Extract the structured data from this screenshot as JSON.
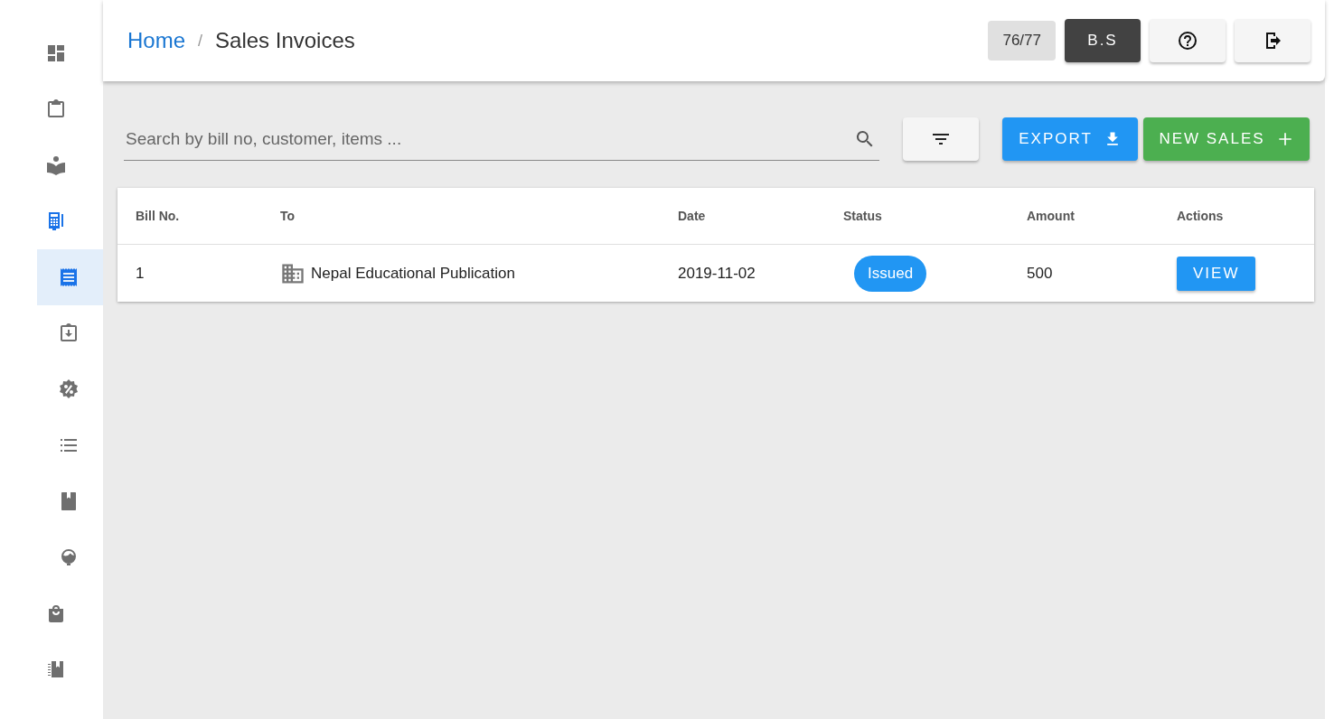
{
  "sidebar": {
    "items": [
      {
        "selected": false
      },
      {
        "selected": false
      },
      {
        "selected": false
      },
      {
        "selected": false,
        "expanded": true,
        "children": [
          {
            "selected": true
          },
          {
            "selected": false
          },
          {
            "selected": false
          },
          {
            "selected": false
          },
          {
            "selected": false
          },
          {
            "selected": false
          }
        ]
      },
      {
        "selected": false
      },
      {
        "selected": false
      }
    ]
  },
  "breadcrumb": {
    "home": "Home",
    "separator": "/",
    "current": "Sales Invoices"
  },
  "header": {
    "counter": "76/77",
    "calendar_button": "B.S"
  },
  "search": {
    "placeholder": "Search by bill no, customer, items ..."
  },
  "buttons": {
    "export": "EXPORT",
    "new_sales": "NEW SALES"
  },
  "table": {
    "columns": [
      "Bill No.",
      "To",
      "Date",
      "Status",
      "Amount",
      "Actions"
    ],
    "rows": [
      {
        "bill_no": "1",
        "to": "Nepal Educational Publication",
        "date": "2019-11-02",
        "status": "Issued",
        "amount": "500",
        "action": "VIEW"
      }
    ]
  }
}
